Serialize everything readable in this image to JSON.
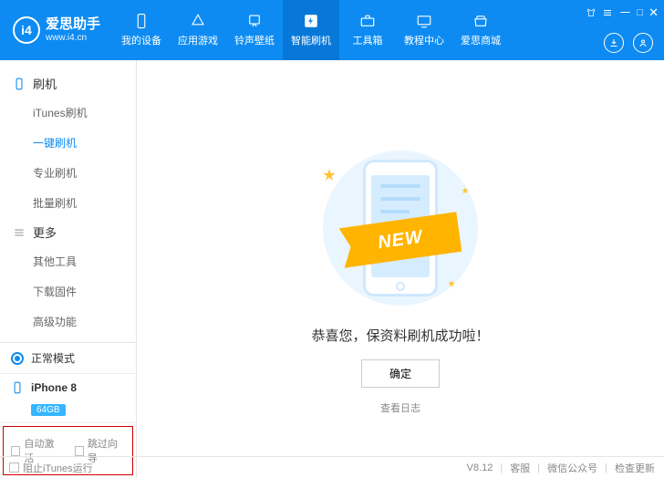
{
  "header": {
    "logo_badge": "i4",
    "app_name": "爱思助手",
    "app_url": "www.i4.cn",
    "nav": [
      {
        "label": "我的设备",
        "icon": "device"
      },
      {
        "label": "应用游戏",
        "icon": "apps"
      },
      {
        "label": "铃声壁纸",
        "icon": "ringtone"
      },
      {
        "label": "智能刷机",
        "icon": "flash",
        "active": true
      },
      {
        "label": "工具箱",
        "icon": "toolbox"
      },
      {
        "label": "教程中心",
        "icon": "tutorial"
      },
      {
        "label": "爱思商城",
        "icon": "store"
      }
    ]
  },
  "sidebar": {
    "group1": {
      "title": "刷机"
    },
    "items1": [
      {
        "label": "iTunes刷机"
      },
      {
        "label": "一键刷机",
        "active": true
      },
      {
        "label": "专业刷机"
      },
      {
        "label": "批量刷机"
      }
    ],
    "group2": {
      "title": "更多"
    },
    "items2": [
      {
        "label": "其他工具"
      },
      {
        "label": "下载固件"
      },
      {
        "label": "高级功能"
      }
    ],
    "mode": "正常模式",
    "device": "iPhone 8",
    "storage": "64GB",
    "auto_activate": "自动激活",
    "skip_wizard": "跳过向导"
  },
  "main": {
    "ribbon": "NEW",
    "message": "恭喜您，保资料刷机成功啦！",
    "ok": "确定",
    "log": "查看日志"
  },
  "footer": {
    "block_itunes": "阻止iTunes运行",
    "version": "V8.12",
    "support": "客服",
    "wechat": "微信公众号",
    "update": "检查更新"
  }
}
